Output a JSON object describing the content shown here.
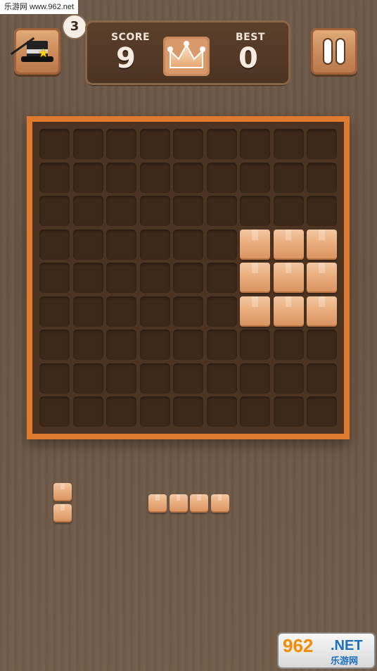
{
  "watermark_top": "乐游网 www.962.net",
  "hint": {
    "count": "3"
  },
  "score": {
    "label": "SCORE",
    "value": "9"
  },
  "best": {
    "label": "BEST",
    "value": "0"
  },
  "board": {
    "rows": 9,
    "cols": 9,
    "filled": [
      [
        3,
        6
      ],
      [
        3,
        7
      ],
      [
        3,
        8
      ],
      [
        4,
        6
      ],
      [
        4,
        7
      ],
      [
        4,
        8
      ],
      [
        5,
        6
      ],
      [
        5,
        7
      ],
      [
        5,
        8
      ]
    ]
  },
  "tray": [
    {
      "name": "vertical-2",
      "cells": [
        [
          0,
          0
        ],
        [
          1,
          0
        ]
      ]
    },
    {
      "name": "horizontal-4",
      "cells": [
        [
          0,
          0
        ],
        [
          0,
          1
        ],
        [
          0,
          2
        ],
        [
          0,
          3
        ]
      ]
    }
  ],
  "watermark_bottom": {
    "number": "962",
    "net": ".NET",
    "cn": "乐游网"
  },
  "colors": {
    "board_frame": "#e07a2f",
    "cell": "#3d2819",
    "block": "#e9ad7d"
  },
  "icons": [
    "magic-hat-icon",
    "star-icon",
    "crown-icon",
    "pause-icon"
  ]
}
